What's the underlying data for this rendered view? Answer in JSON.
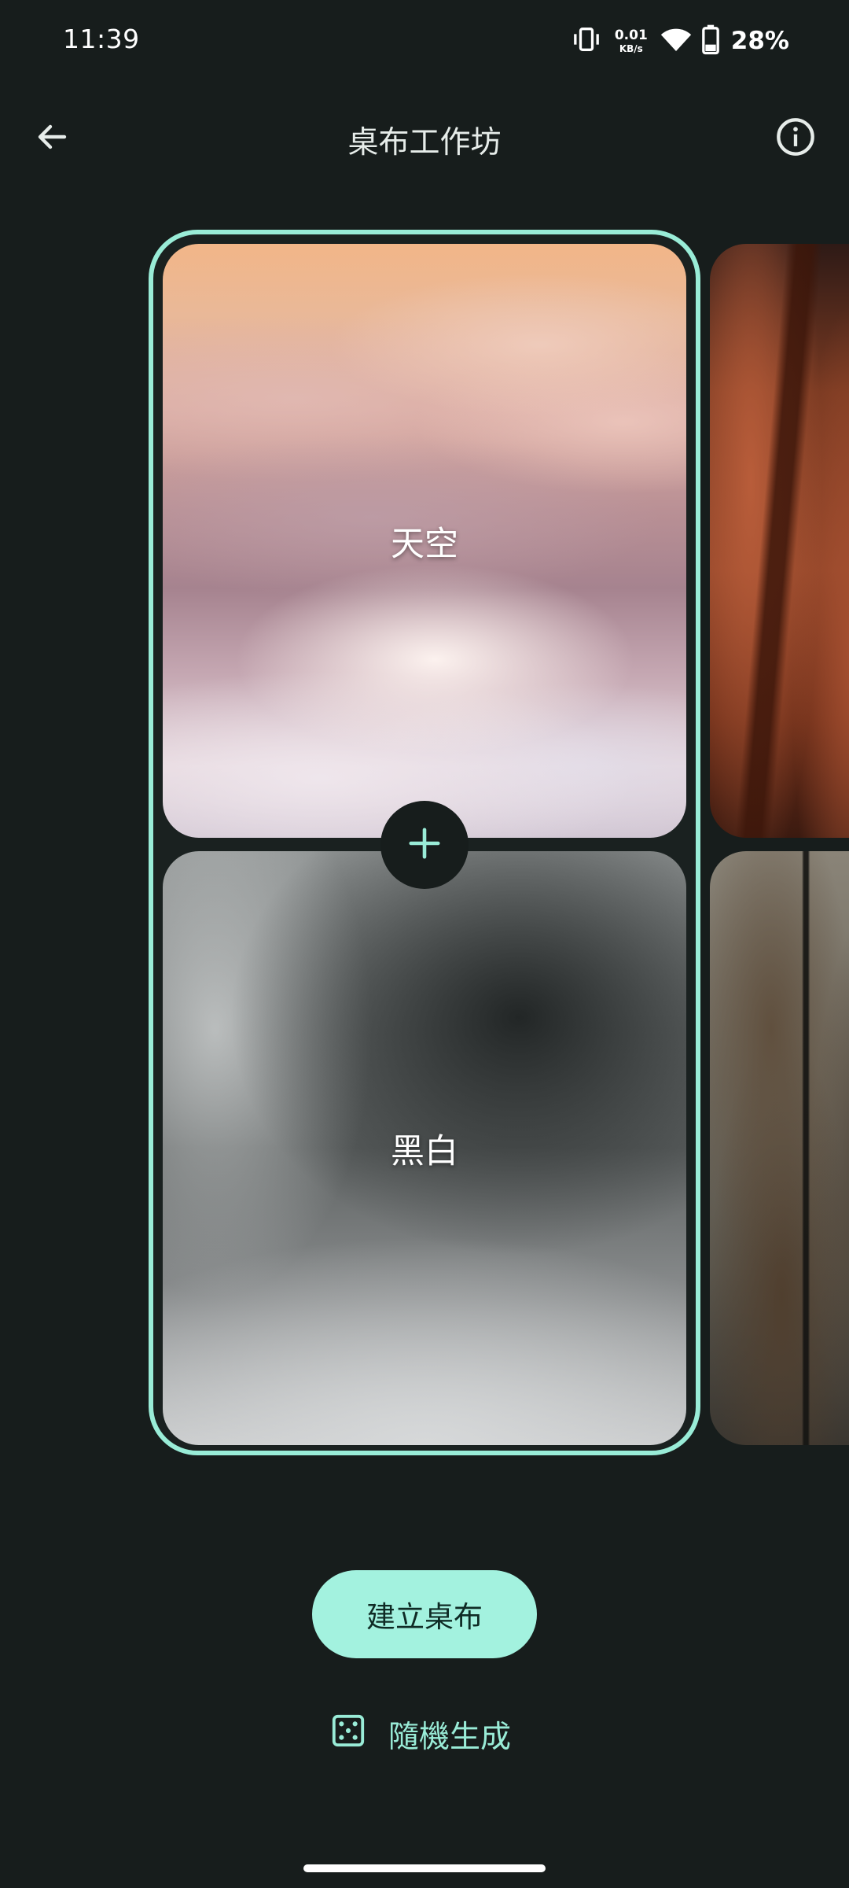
{
  "status_bar": {
    "time": "11:39",
    "net_speed_value": "0.01",
    "net_speed_unit": "KB/s",
    "battery_percent": "28%",
    "icons": [
      "vibrate-icon",
      "wifi-icon",
      "battery-icon"
    ]
  },
  "app_bar": {
    "title": "桌布工作坊",
    "back_icon": "arrow-back-icon",
    "info_icon": "info-icon"
  },
  "carousel": {
    "selected_set": {
      "top_label": "天空",
      "bottom_label": "黑白"
    },
    "add_icon": "plus-icon"
  },
  "actions": {
    "create_label": "建立桌布",
    "random_label": "隨機生成",
    "random_icon": "dice-icon"
  },
  "colors": {
    "background": "#171d1c",
    "accent": "#99ecd7",
    "primary_button": "#a3f2df",
    "primary_button_text": "#0f2b25"
  }
}
